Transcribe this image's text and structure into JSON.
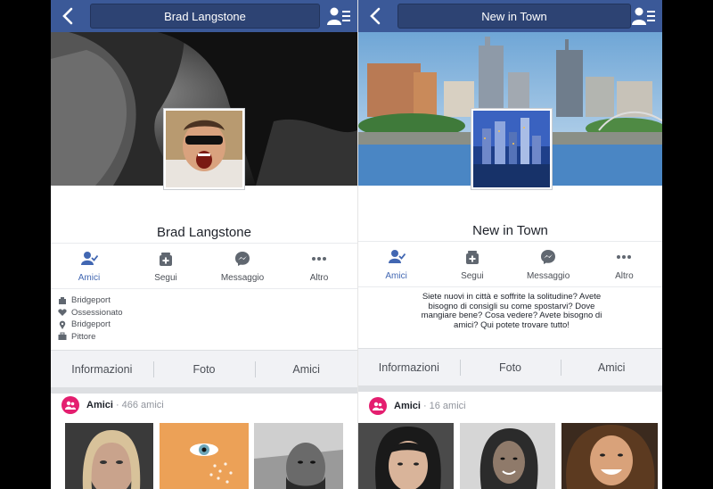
{
  "left": {
    "title": "Brad Langstone",
    "name": "Brad Langstone",
    "actions": [
      {
        "label": "Amici",
        "icon": "friends-check-icon",
        "active": true
      },
      {
        "label": "Segui",
        "icon": "follow-icon",
        "active": false
      },
      {
        "label": "Messaggio",
        "icon": "messenger-icon",
        "active": false
      },
      {
        "label": "Altro",
        "icon": "more-icon",
        "active": false
      }
    ],
    "info": [
      {
        "icon": "work-icon",
        "text": "Bridgeport"
      },
      {
        "icon": "heart-icon",
        "text": "Ossessionato"
      },
      {
        "icon": "location-pin-icon",
        "text": "Bridgeport"
      },
      {
        "icon": "briefcase-icon",
        "text": "Pittore"
      }
    ],
    "tabs": [
      "Informazioni",
      "Foto",
      "Amici"
    ],
    "friends": {
      "title": "Amici",
      "count": "466 amici"
    }
  },
  "right": {
    "title": "New in Town",
    "name": "New in Town",
    "actions": [
      {
        "label": "Amici",
        "icon": "friends-check-icon",
        "active": true
      },
      {
        "label": "Segui",
        "icon": "follow-icon",
        "active": false
      },
      {
        "label": "Messaggio",
        "icon": "messenger-icon",
        "active": false
      },
      {
        "label": "Altro",
        "icon": "more-icon",
        "active": false
      }
    ],
    "description": "Siete nuovi in città e soffrite la solitudine? Avete bisogno di consigli su come spostarvi? Dove mangiare bene? Cosa vedere? Avete bisogno di amici? Qui potete trovare tutto!",
    "tabs": [
      "Informazioni",
      "Foto",
      "Amici"
    ],
    "friends": {
      "title": "Amici",
      "count": "16 amici"
    }
  },
  "colors": {
    "header": "#3b5998",
    "accent": "#4267b2",
    "friends_badge": "#e41e6f"
  }
}
